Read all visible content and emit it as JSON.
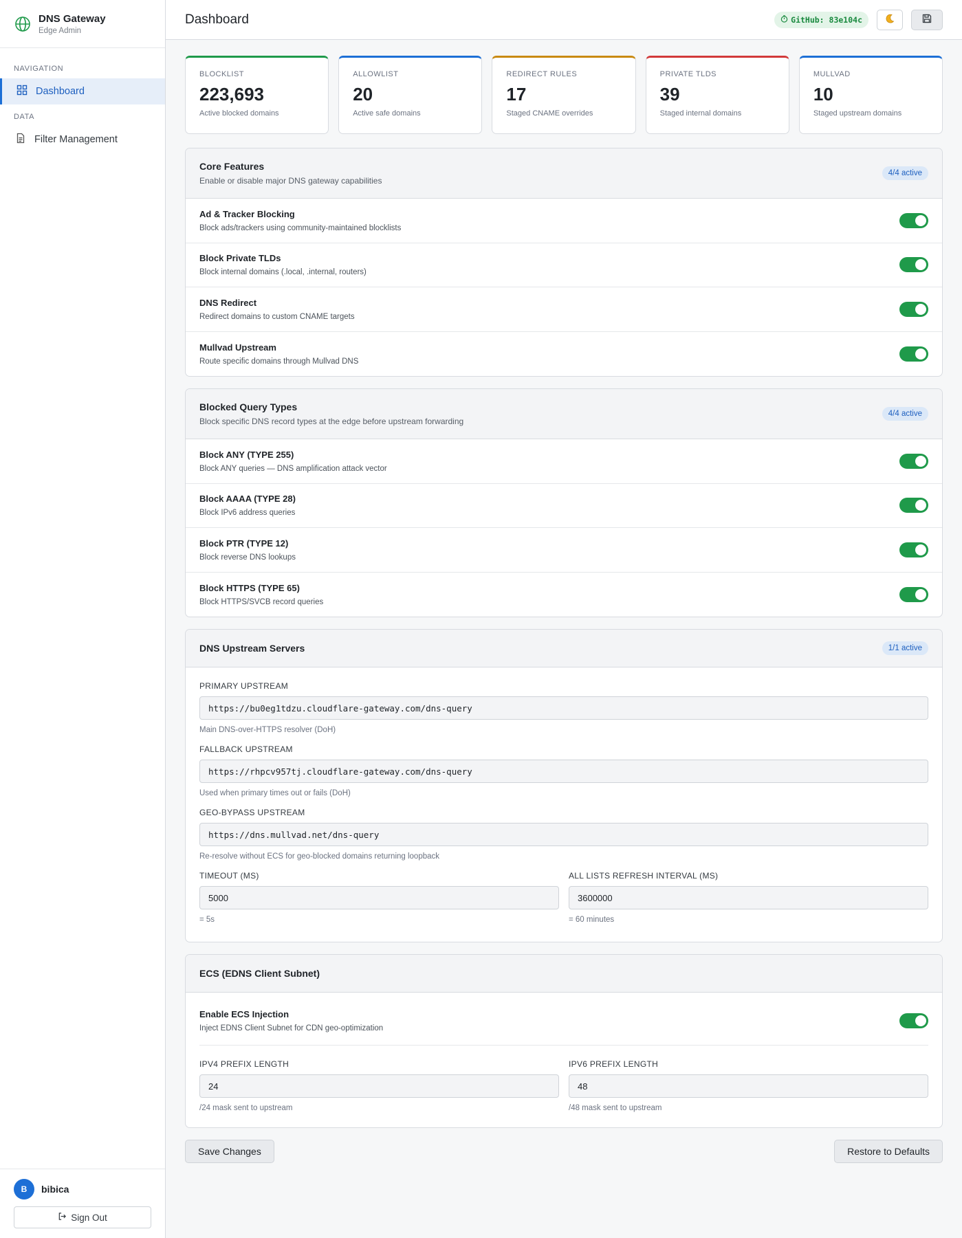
{
  "brand": {
    "title": "DNS Gateway",
    "subtitle": "Edge Admin"
  },
  "sidebar": {
    "sections": [
      "NAVIGATION",
      "DATA"
    ],
    "items": [
      {
        "label": "Dashboard",
        "icon": "grid-icon",
        "active": true
      },
      {
        "label": "Filter Management",
        "icon": "document-icon",
        "active": false
      }
    ],
    "user": {
      "initial": "B",
      "name": "bibica"
    },
    "signout_label": "Sign Out"
  },
  "header": {
    "title": "Dashboard",
    "github_label": "GitHub: 83e104c"
  },
  "stats": [
    {
      "label": "BLOCKLIST",
      "value": "223,693",
      "desc": "Active blocked domains",
      "color": "#1f9a4a"
    },
    {
      "label": "ALLOWLIST",
      "value": "20",
      "desc": "Active safe domains",
      "color": "#1d6fd6"
    },
    {
      "label": "REDIRECT RULES",
      "value": "17",
      "desc": "Staged CNAME overrides",
      "color": "#c98a12"
    },
    {
      "label": "PRIVATE TLDS",
      "value": "39",
      "desc": "Staged internal domains",
      "color": "#d23a3a"
    },
    {
      "label": "MULLVAD",
      "value": "10",
      "desc": "Staged upstream domains",
      "color": "#1d6fd6"
    }
  ],
  "core": {
    "title": "Core Features",
    "subtitle": "Enable or disable major DNS gateway capabilities",
    "badge": "4/4 active",
    "rows": [
      {
        "name": "Ad & Tracker Blocking",
        "desc": "Block ads/trackers using community-maintained blocklists",
        "on": true
      },
      {
        "name": "Block Private TLDs",
        "desc": "Block internal domains (.local, .internal, routers)",
        "on": true
      },
      {
        "name": "DNS Redirect",
        "desc": "Redirect domains to custom CNAME targets",
        "on": true
      },
      {
        "name": "Mullvad Upstream",
        "desc": "Route specific domains through Mullvad DNS",
        "on": true
      }
    ]
  },
  "query_types": {
    "title": "Blocked Query Types",
    "subtitle": "Block specific DNS record types at the edge before upstream forwarding",
    "badge": "4/4 active",
    "rows": [
      {
        "name": "Block ANY (TYPE 255)",
        "desc": "Block ANY queries — DNS amplification attack vector",
        "on": true
      },
      {
        "name": "Block AAAA (TYPE 28)",
        "desc": "Block IPv6 address queries",
        "on": true
      },
      {
        "name": "Block PTR (TYPE 12)",
        "desc": "Block reverse DNS lookups",
        "on": true
      },
      {
        "name": "Block HTTPS (TYPE 65)",
        "desc": "Block HTTPS/SVCB record queries",
        "on": true
      }
    ]
  },
  "upstream": {
    "title": "DNS Upstream Servers",
    "badge": "1/1 active",
    "primary": {
      "label": "PRIMARY UPSTREAM",
      "value": "https://bu0eg1tdzu.cloudflare-gateway.com/dns-query",
      "hint": "Main DNS-over-HTTPS resolver (DoH)"
    },
    "fallback": {
      "label": "FALLBACK UPSTREAM",
      "value": "https://rhpcv957tj.cloudflare-gateway.com/dns-query",
      "hint": "Used when primary times out or fails (DoH)"
    },
    "geo": {
      "label": "GEO-BYPASS UPSTREAM",
      "value": "https://dns.mullvad.net/dns-query",
      "hint": "Re-resolve without ECS for geo-blocked domains returning loopback"
    },
    "timeout": {
      "label": "TIMEOUT (MS)",
      "value": "5000",
      "hint": "= 5s"
    },
    "refresh": {
      "label": "ALL LISTS REFRESH INTERVAL (MS)",
      "value": "3600000",
      "hint": "= 60 minutes"
    }
  },
  "ecs": {
    "title": "ECS (EDNS Client Subnet)",
    "enable": {
      "name": "Enable ECS Injection",
      "desc": "Inject EDNS Client Subnet for CDN geo-optimization",
      "on": true
    },
    "ipv4": {
      "label": "IPV4 PREFIX LENGTH",
      "value": "24",
      "hint": "/24 mask sent to upstream"
    },
    "ipv6": {
      "label": "IPV6 PREFIX LENGTH",
      "value": "48",
      "hint": "/48 mask sent to upstream"
    }
  },
  "actions": {
    "save": "Save Changes",
    "restore": "Restore to Defaults"
  }
}
